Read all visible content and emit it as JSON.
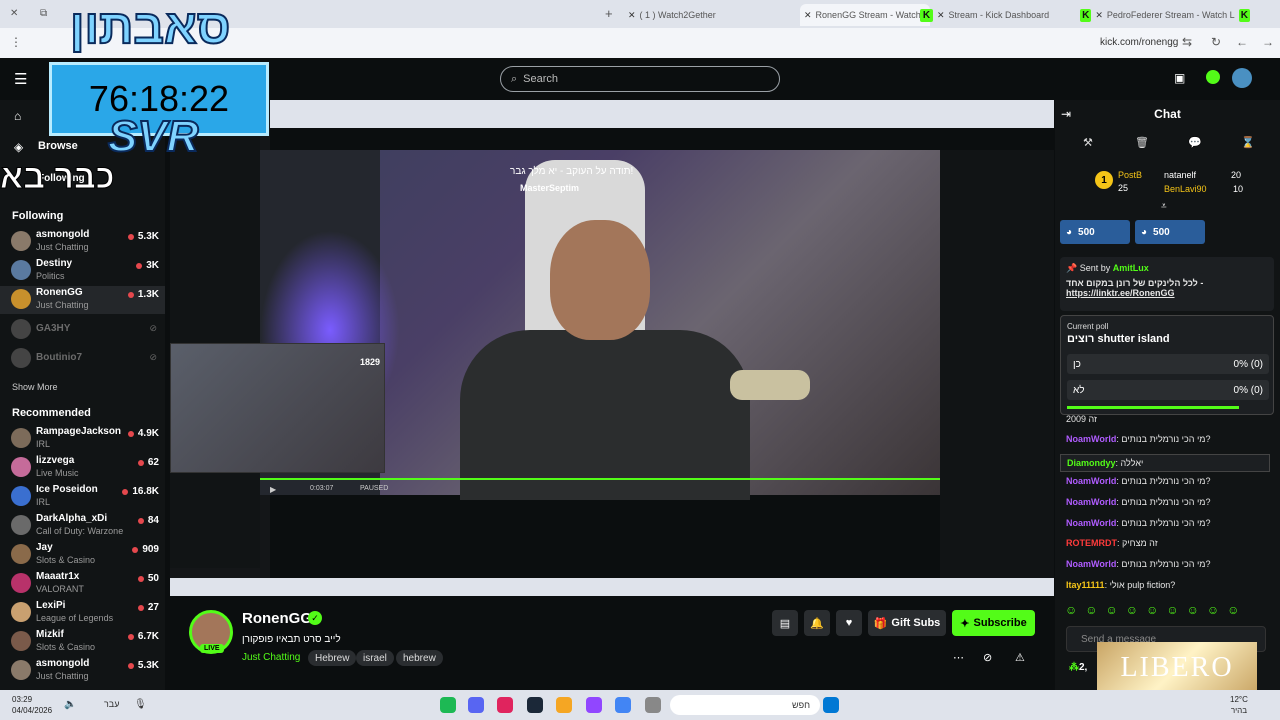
{
  "browser": {
    "tabs": [
      {
        "label": "( 1 ) Watch2Gether",
        "active": false
      },
      {
        "label": "RonenGG Stream - Watch L",
        "active": true
      },
      {
        "label": "Stream - Kick Dashboard",
        "active": false
      },
      {
        "label": "PedroFederer Stream - Watch L",
        "active": false
      }
    ],
    "address": "kick.com/ronengg"
  },
  "overlay": {
    "timer": "76:18:22",
    "logo": "SVR",
    "heb_top": "סאבתון",
    "heb_mid": "כבר בא"
  },
  "search": {
    "placeholder": "Search"
  },
  "sidebar": {
    "browse": "Browse",
    "following_tab": "Following",
    "following_label": "Following",
    "show_more": "Show More",
    "recommended_label": "Recommended",
    "following": [
      {
        "name": "asmongold",
        "category": "Just Chatting",
        "viewers": "5.3K"
      },
      {
        "name": "Destiny",
        "category": "Politics",
        "viewers": "3K"
      },
      {
        "name": "RonenGG",
        "category": "Just Chatting",
        "viewers": "1.3K"
      },
      {
        "name": "GA3HY",
        "category": "",
        "viewers": ""
      },
      {
        "name": "Boutinio7",
        "category": "",
        "viewers": ""
      }
    ],
    "recommended": [
      {
        "name": "RampageJackson",
        "category": "IRL",
        "viewers": "4.9K"
      },
      {
        "name": "lizzvega",
        "category": "Live Music",
        "viewers": "62"
      },
      {
        "name": "Ice Poseidon",
        "category": "IRL",
        "viewers": "16.8K"
      },
      {
        "name": "DarkAlpha_xDi",
        "category": "Call of Duty: Warzone",
        "viewers": "84"
      },
      {
        "name": "Jay",
        "category": "Slots & Casino",
        "viewers": "909"
      },
      {
        "name": "Maaatr1x",
        "category": "VALORANT",
        "viewers": "50"
      },
      {
        "name": "LexiPi",
        "category": "League of Legends",
        "viewers": "27"
      },
      {
        "name": "Mizkif",
        "category": "Slots & Casino",
        "viewers": "6.7K"
      },
      {
        "name": "asmongold",
        "category": "Just Chatting",
        "viewers": "5.3K"
      }
    ]
  },
  "player": {
    "caption": "תודה על העוקב - יא מלך גבר!",
    "caption_user": "MasterSeptim",
    "mini_count": "1829",
    "time": "0:03:07",
    "status": "PAUSED"
  },
  "stream": {
    "name": "RonenGG",
    "title": "לייב סרט תבאיו פופקורן",
    "category": "Just Chatting",
    "tags": [
      "Hebrew",
      "israel",
      "hebrew"
    ],
    "live": "LIVE",
    "gift_subs": "Gift Subs",
    "subscribe": "Subscribe"
  },
  "chat": {
    "title": "Chat",
    "leaderboard": [
      {
        "rank": "1",
        "name": "PostB",
        "value": "25"
      },
      {
        "name": "natanelf",
        "value": "20"
      },
      {
        "name": "BenLavi90",
        "value": "10"
      }
    ],
    "pills": [
      "500",
      "500"
    ],
    "pinned": {
      "sent_by_label": "Sent by",
      "user": "AmitLux",
      "text": "לכל הלינקים של רונן במקום אחד -",
      "link": "https://linktr.ee/RonenGG"
    },
    "poll": {
      "label": "Current poll",
      "question": "רוצים shutter island",
      "options": [
        {
          "label": "כן",
          "result": "0% (0)"
        },
        {
          "label": "לא",
          "result": "0% (0)"
        }
      ]
    },
    "messages": [
      {
        "user": "",
        "text": "זה 2009"
      },
      {
        "user": "NoamWorld",
        "text": "מי הכי נורמלית בנותים?"
      },
      {
        "user": "Diamondyy",
        "text": "יאללה"
      },
      {
        "user": "NoamWorld",
        "text": "מי הכי נורמלית בנותים?"
      },
      {
        "user": "NoamWorld",
        "text": "מי הכי נורמלית בנותים?"
      },
      {
        "user": "NoamWorld",
        "text": "מי הכי נורמלית בנותים?"
      },
      {
        "user": "ROTEMRDT",
        "text": "זה מצחיק"
      },
      {
        "user": "NoamWorld",
        "text": "מי הכי נורמלית בנותים?"
      },
      {
        "user": "Itay11111",
        "text": "אולי pulp fiction?"
      }
    ],
    "input_placeholder": "Send a message",
    "points": "2,",
    "sponsor": "LIBERO"
  },
  "os": {
    "time": "03:29",
    "date": "04/04/2026",
    "lang": "עבר",
    "search": "חפש",
    "temp": "12°C",
    "weather": "בהיר"
  },
  "colors": {
    "accent": "#53fc18",
    "bg": "#0b0e0f",
    "panel": "#111415"
  }
}
